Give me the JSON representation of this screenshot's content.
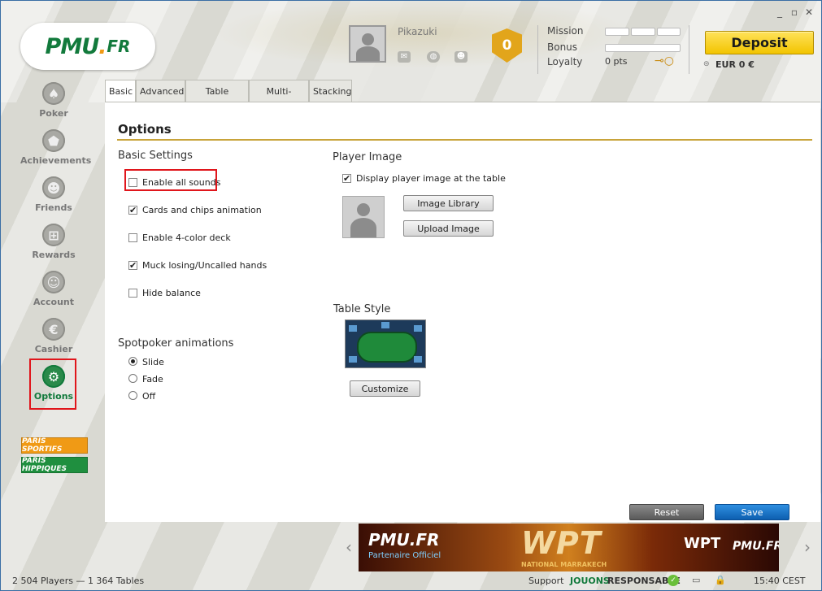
{
  "window": {
    "controls": [
      "_",
      "▫",
      "✕"
    ]
  },
  "logo": {
    "text_main": "PMU",
    "text_dot": ".",
    "text_tld": "FR"
  },
  "sidebar": {
    "items": [
      {
        "label": "Poker",
        "icon": "spade-icon",
        "glyph": "♠"
      },
      {
        "label": "Achievements",
        "icon": "shield-icon",
        "glyph": "⬟"
      },
      {
        "label": "Friends",
        "icon": "friends-icon",
        "glyph": "👥"
      },
      {
        "label": "Rewards",
        "icon": "gift-icon",
        "glyph": "⊞"
      },
      {
        "label": "Account",
        "icon": "account-icon",
        "glyph": "👤"
      },
      {
        "label": "Cashier",
        "icon": "euro-icon",
        "glyph": "€"
      },
      {
        "label": "Options",
        "icon": "wrench-icon",
        "glyph": "🔧"
      }
    ],
    "promos": [
      {
        "label": "PARIS SPORTIFS",
        "color": "#f09a15"
      },
      {
        "label": "PARIS HIPPIQUES",
        "color": "#1f8f3f"
      }
    ]
  },
  "header": {
    "username": "Pikazuki",
    "level_badge": "0",
    "mission_label": "Mission",
    "bonus_label": "Bonus",
    "loyalty_label": "Loyalty",
    "loyalty_value": "0 pts",
    "deposit_label": "Deposit",
    "balance": "EUR 0 €"
  },
  "tabs": [
    "Basic",
    "Advanced",
    "Table options",
    "Multi-tabling",
    "Stacking"
  ],
  "options": {
    "title": "Options",
    "basic_settings_title": "Basic Settings",
    "settings": [
      {
        "label": "Enable all sounds",
        "checked": false
      },
      {
        "label": "Cards and chips animation",
        "checked": true
      },
      {
        "label": "Enable 4-color deck",
        "checked": false
      },
      {
        "label": "Muck losing/Uncalled hands",
        "checked": true
      },
      {
        "label": "Hide balance",
        "checked": false
      }
    ],
    "spotpoker_title": "Spotpoker animations",
    "spotpoker_options": [
      {
        "label": "Slide",
        "selected": true
      },
      {
        "label": "Fade",
        "selected": false
      },
      {
        "label": "Off",
        "selected": false
      }
    ],
    "player_image_title": "Player Image",
    "display_player_image_label": "Display player image at the table",
    "display_player_image_checked": true,
    "image_library_label": "Image Library",
    "upload_image_label": "Upload Image",
    "table_style_title": "Table Style",
    "customize_label": "Customize",
    "reset_label": "Reset",
    "save_label": "Save"
  },
  "banner": {
    "brand": "PMU.FR",
    "tagline": "Partenaire Officiel",
    "event": "WPT",
    "event_sub": "NATIONAL MARRAKECH",
    "right_logo": "WPT",
    "right_brand": "PMU.FR"
  },
  "status": {
    "players_tables": "2 504 Players  —  1 364 Tables",
    "support": "Support",
    "jouons": "JOUONS",
    "responsable": "RESPONSABLE",
    "time": "15:40 CEST"
  },
  "colors": {
    "brand_green": "#127a3c",
    "brand_orange": "#f09a15",
    "deposit_yellow": "#f2c400",
    "highlight_red": "#e0161c",
    "save_blue": "#0d5fb0"
  }
}
